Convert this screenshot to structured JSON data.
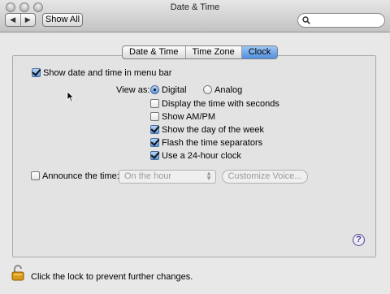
{
  "window": {
    "title": "Date & Time"
  },
  "toolbar": {
    "back_glyph": "◀",
    "forward_glyph": "▶",
    "show_all_label": "Show All",
    "search_placeholder": ""
  },
  "tabs": [
    {
      "label": "Date & Time",
      "selected": false
    },
    {
      "label": "Time Zone",
      "selected": false
    },
    {
      "label": "Clock",
      "selected": true
    }
  ],
  "clock": {
    "show_in_menu_bar": {
      "label": "Show date and time in menu bar",
      "checked": true
    },
    "view_as_label": "View as:",
    "view_options": [
      {
        "label": "Digital",
        "selected": true
      },
      {
        "label": "Analog",
        "selected": false
      }
    ],
    "options": [
      {
        "label": "Display the time with seconds",
        "checked": false
      },
      {
        "label": "Show AM/PM",
        "checked": false
      },
      {
        "label": "Show the day of the week",
        "checked": true
      },
      {
        "label": "Flash the time separators",
        "checked": true
      },
      {
        "label": "Use a 24-hour clock",
        "checked": true
      }
    ],
    "announce": {
      "label": "Announce the time:",
      "checked": false
    },
    "announce_interval": "On the hour",
    "customize_voice_label": "Customize Voice..."
  },
  "help_glyph": "?",
  "lock_text": "Click the lock to prevent further changes.",
  "colors": {
    "accent": "#5a97e2",
    "panel": "#e3e3e3",
    "window": "#e8e8e8"
  },
  "icons": [
    "close-icon",
    "minimize-icon",
    "zoom-icon",
    "search-icon",
    "help-icon",
    "lock-icon",
    "mouse-pointer-icon"
  ]
}
